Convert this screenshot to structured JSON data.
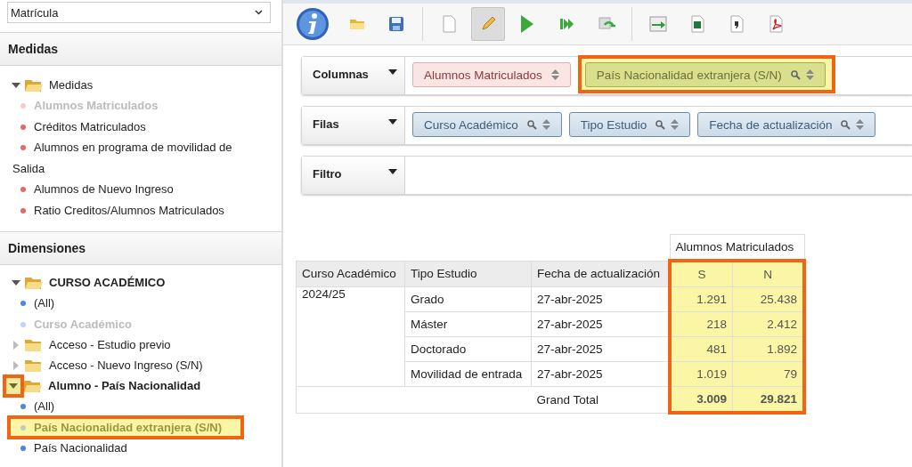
{
  "cube_select": {
    "value": "Matrícula"
  },
  "measures": {
    "title": "Medidas",
    "kind": "measure",
    "tree": [
      {
        "label": "Medidas",
        "kind": "folder",
        "expanded": true,
        "highlighted": false,
        "children": [
          {
            "label": "Alumnos Matriculados",
            "kind": "leaf",
            "disabled": true,
            "highlighted": false
          },
          {
            "label": "Créditos Matriculados",
            "kind": "leaf",
            "disabled": false,
            "highlighted": false
          },
          {
            "label": "Alumnos en programa de movilidad de Salida",
            "kind": "leaf",
            "disabled": false,
            "highlighted": false
          },
          {
            "label": "Alumnos de Nuevo Ingreso",
            "kind": "leaf",
            "disabled": false,
            "highlighted": false
          },
          {
            "label": "Ratio Creditos/Alumnos Matriculados",
            "kind": "leaf",
            "disabled": false,
            "highlighted": false
          }
        ]
      }
    ]
  },
  "dimensions": {
    "title": "Dimensiones",
    "kind": "dimension",
    "tree": [
      {
        "label": "CURSO ACADÉMICO",
        "kind": "folder",
        "expanded": true,
        "highlighted": false,
        "children": [
          {
            "label": "(All)",
            "kind": "leaf",
            "disabled": false,
            "highlighted": false
          },
          {
            "label": "Curso Académico",
            "kind": "leaf",
            "disabled": true,
            "highlighted": false
          }
        ]
      },
      {
        "label": "Acceso - Estudio previo",
        "kind": "folder",
        "expanded": false,
        "highlighted": false
      },
      {
        "label": "Acceso - Nuevo Ingreso (S/N)",
        "kind": "folder",
        "expanded": false,
        "highlighted": false
      },
      {
        "label": "Alumno - País Nacionalidad",
        "kind": "folder",
        "expanded": true,
        "highlighted": true,
        "children": [
          {
            "label": "(All)",
            "kind": "leaf",
            "disabled": false,
            "highlighted": false
          },
          {
            "label": "País Nacionalidad extranjera (S/N)",
            "kind": "leaf",
            "disabled": true,
            "highlighted": true
          },
          {
            "label": "País Nacionalidad",
            "kind": "leaf",
            "disabled": false,
            "highlighted": false
          }
        ]
      }
    ]
  },
  "toolbar": [
    {
      "kind": "info"
    },
    {
      "kind": "open",
      "selected": false
    },
    {
      "kind": "save",
      "selected": false
    },
    {
      "kind": "separator"
    },
    {
      "kind": "new",
      "selected": false
    },
    {
      "kind": "edit",
      "selected": true
    },
    {
      "kind": "run",
      "selected": false
    },
    {
      "kind": "run-all",
      "selected": false
    },
    {
      "kind": "refresh",
      "selected": false
    },
    {
      "kind": "separator"
    },
    {
      "kind": "export",
      "selected": false
    },
    {
      "kind": "excel",
      "selected": false
    },
    {
      "kind": "doc",
      "selected": false
    },
    {
      "kind": "pdf",
      "selected": false
    }
  ],
  "axes": [
    {
      "label": "Columnas",
      "chips": [
        {
          "label": "Alumnos Matriculados",
          "kind": "measure",
          "filter": false,
          "highlighted": false
        },
        {
          "label": "País Nacionalidad extranjera (S/N)",
          "kind": "dimension",
          "filter": true,
          "highlighted": true
        }
      ]
    },
    {
      "label": "Filas",
      "chips": [
        {
          "label": "Curso Académico",
          "kind": "dimension",
          "filter": true,
          "highlighted": false
        },
        {
          "label": "Tipo Estudio",
          "kind": "dimension",
          "filter": true,
          "highlighted": false
        },
        {
          "label": "Fecha de actualización",
          "kind": "dimension",
          "filter": true,
          "highlighted": false
        }
      ]
    },
    {
      "label": "Filtro"
    }
  ],
  "table": {
    "measure_header": "Alumnos Matriculados",
    "highlighted": true,
    "row_headers": [
      "Curso Académico",
      "Tipo Estudio",
      "Fecha de actualización"
    ],
    "value_headers": [
      "S",
      "N"
    ],
    "rows": [
      {
        "curso": "2024/25",
        "tipo": "Grado",
        "fecha": "27-abr-2025",
        "values": [
          "1.291",
          "25.438"
        ]
      },
      {
        "tipo": "Máster",
        "fecha": "27-abr-2025",
        "values": [
          "218",
          "2.412"
        ]
      },
      {
        "tipo": "Doctorado",
        "fecha": "27-abr-2025",
        "values": [
          "481",
          "1.892"
        ]
      },
      {
        "tipo": "Movilidad de entrada",
        "fecha": "27-abr-2025",
        "values": [
          "1.019",
          "79"
        ]
      }
    ],
    "total": {
      "label": "Grand Total",
      "values": [
        "3.009",
        "29.821"
      ]
    }
  }
}
